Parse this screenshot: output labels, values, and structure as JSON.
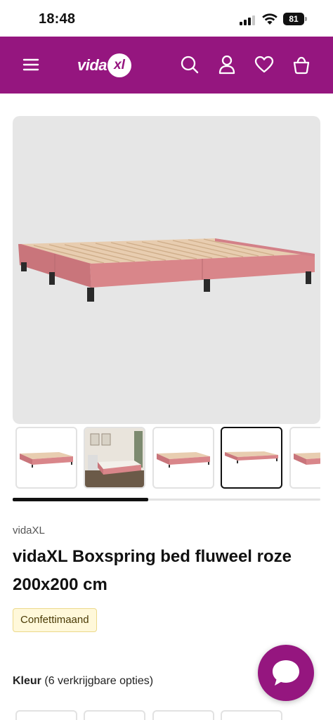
{
  "status_bar": {
    "time": "18:48",
    "battery": "81"
  },
  "header": {
    "logo_text": "vida",
    "logo_mark": "xl",
    "icons": [
      "menu-icon",
      "search-icon",
      "account-icon",
      "heart-icon",
      "cart-icon"
    ]
  },
  "gallery": {
    "thumbnail_count": 5,
    "selected_index": 3,
    "scroll_progress": 0.44
  },
  "product": {
    "brand": "vidaXL",
    "title": "vidaXL Boxspring bed fluweel roze 200x200 cm",
    "promo_badge": "Confettimaand"
  },
  "color_selector": {
    "label": "Kleur",
    "options_text": "(6 verkrijgbare opties)"
  },
  "colors": {
    "brand_purple": "#95167f",
    "bed_pink": "#d9868a",
    "background": "#ffffff"
  }
}
